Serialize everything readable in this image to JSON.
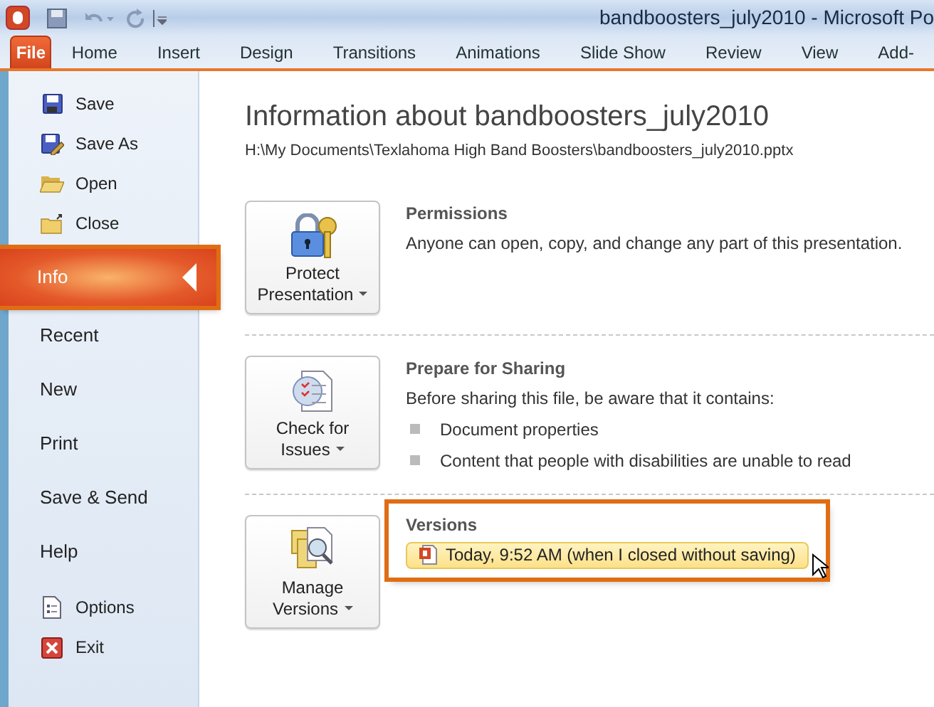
{
  "window": {
    "title": "bandboosters_july2010  -  Microsoft Po"
  },
  "ribbon_tabs": [
    {
      "label": "File",
      "selected": true
    },
    {
      "label": "Home",
      "selected": false
    },
    {
      "label": "Insert",
      "selected": false
    },
    {
      "label": "Design",
      "selected": false
    },
    {
      "label": "Transitions",
      "selected": false
    },
    {
      "label": "Animations",
      "selected": false
    },
    {
      "label": "Slide Show",
      "selected": false
    },
    {
      "label": "Review",
      "selected": false
    },
    {
      "label": "View",
      "selected": false
    },
    {
      "label": "Add-",
      "selected": false
    }
  ],
  "sidebar": {
    "items": [
      {
        "label": "Save",
        "kind": "command",
        "selected": false
      },
      {
        "label": "Save As",
        "kind": "command",
        "selected": false
      },
      {
        "label": "Open",
        "kind": "command",
        "selected": false
      },
      {
        "label": "Close",
        "kind": "command",
        "selected": false
      },
      {
        "label": "Info",
        "kind": "tab",
        "selected": true
      },
      {
        "label": "Recent",
        "kind": "tab",
        "selected": false
      },
      {
        "label": "New",
        "kind": "tab",
        "selected": false
      },
      {
        "label": "Print",
        "kind": "tab",
        "selected": false
      },
      {
        "label": "Save & Send",
        "kind": "tab",
        "selected": false
      },
      {
        "label": "Help",
        "kind": "tab",
        "selected": false
      },
      {
        "label": "Options",
        "kind": "command",
        "selected": false
      },
      {
        "label": "Exit",
        "kind": "command",
        "selected": false
      }
    ]
  },
  "info": {
    "title": "Information about bandboosters_july2010",
    "path": "H:\\My Documents\\Texlahoma High Band Boosters\\bandboosters_july2010.pptx",
    "sections": [
      {
        "button": [
          "Protect",
          "Presentation"
        ],
        "heading": "Permissions",
        "text": "Anyone can open, copy, and change any part of this presentation.",
        "highlighted": false
      },
      {
        "button": [
          "Check for",
          "Issues"
        ],
        "heading": "Prepare for Sharing",
        "text": "Before sharing this file, be aware that it contains:",
        "bullets": [
          "Document properties",
          "Content that people with disabilities are unable to read"
        ],
        "highlighted": false
      },
      {
        "button": [
          "Manage",
          "Versions"
        ],
        "heading": "Versions",
        "versions": [
          "Today, 9:52 AM (when I closed without saving)"
        ],
        "highlighted": true
      }
    ]
  }
}
